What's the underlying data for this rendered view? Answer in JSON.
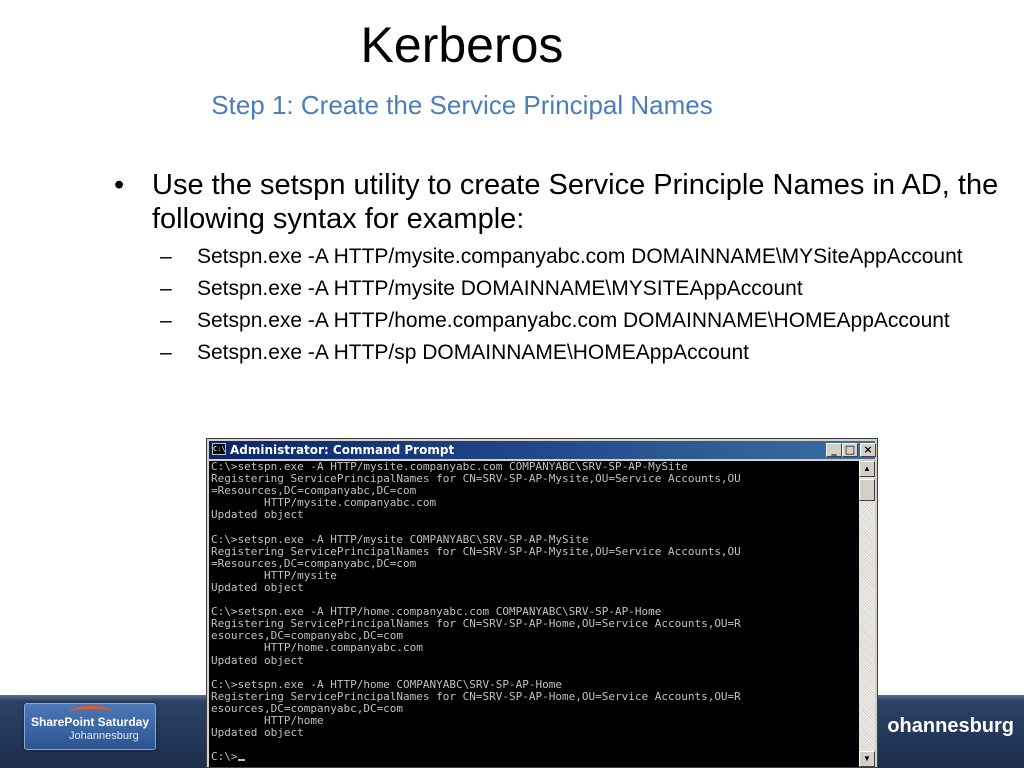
{
  "slide": {
    "title": "Kerberos",
    "subtitle": "Step 1: Create the Service Principal Names",
    "bullet_symbol": "•",
    "dash_symbol": "–",
    "bullet": "Use the setspn utility to create Service Principle Names in AD, the following syntax for example:",
    "sub_items": [
      "Setspn.exe -A HTTP/mysite.companyabc.com DOMAINNAME\\MYSiteAppAccount",
      "Setspn.exe -A HTTP/mysite DOMAINNAME\\MYSITEAppAccount",
      "Setspn.exe -A HTTP/home.companyabc.com DOMAINNAME\\HOMEAppAccount",
      "Setspn.exe -A HTTP/sp DOMAINNAME\\HOMEAppAccount"
    ]
  },
  "footer": {
    "logo_line1": "SharePoint Saturday",
    "logo_line2": "Johannesburg",
    "right_text": "ohannesburg",
    "band_color": "#23375a"
  },
  "cmd": {
    "title": "Administrator: Command Prompt",
    "sys_icon": "C:\\",
    "buttons": {
      "minimize": "_",
      "maximize": "□",
      "close": "×"
    },
    "scroll_up": "▲",
    "scroll_down": "▼",
    "lines": [
      "C:\\>setspn.exe -A HTTP/mysite.companyabc.com COMPANYABC\\SRV-SP-AP-MySite",
      "Registering ServicePrincipalNames for CN=SRV-SP-AP-Mysite,OU=Service Accounts,OU",
      "=Resources,DC=companyabc,DC=com",
      "        HTTP/mysite.companyabc.com",
      "Updated object",
      "",
      "C:\\>setspn.exe -A HTTP/mysite COMPANYABC\\SRV-SP-AP-MySite",
      "Registering ServicePrincipalNames for CN=SRV-SP-AP-Mysite,OU=Service Accounts,OU",
      "=Resources,DC=companyabc,DC=com",
      "        HTTP/mysite",
      "Updated object",
      "",
      "C:\\>setspn.exe -A HTTP/home.companyabc.com COMPANYABC\\SRV-SP-AP-Home",
      "Registering ServicePrincipalNames for CN=SRV-SP-AP-Home,OU=Service Accounts,OU=R",
      "esources,DC=companyabc,DC=com",
      "        HTTP/home.companyabc.com",
      "Updated object",
      "",
      "C:\\>setspn.exe -A HTTP/home COMPANYABC\\SRV-SP-AP-Home",
      "Registering ServicePrincipalNames for CN=SRV-SP-AP-Home,OU=Service Accounts,OU=R",
      "esources,DC=companyabc,DC=com",
      "        HTTP/home",
      "Updated object",
      "",
      "C:\\>"
    ]
  }
}
